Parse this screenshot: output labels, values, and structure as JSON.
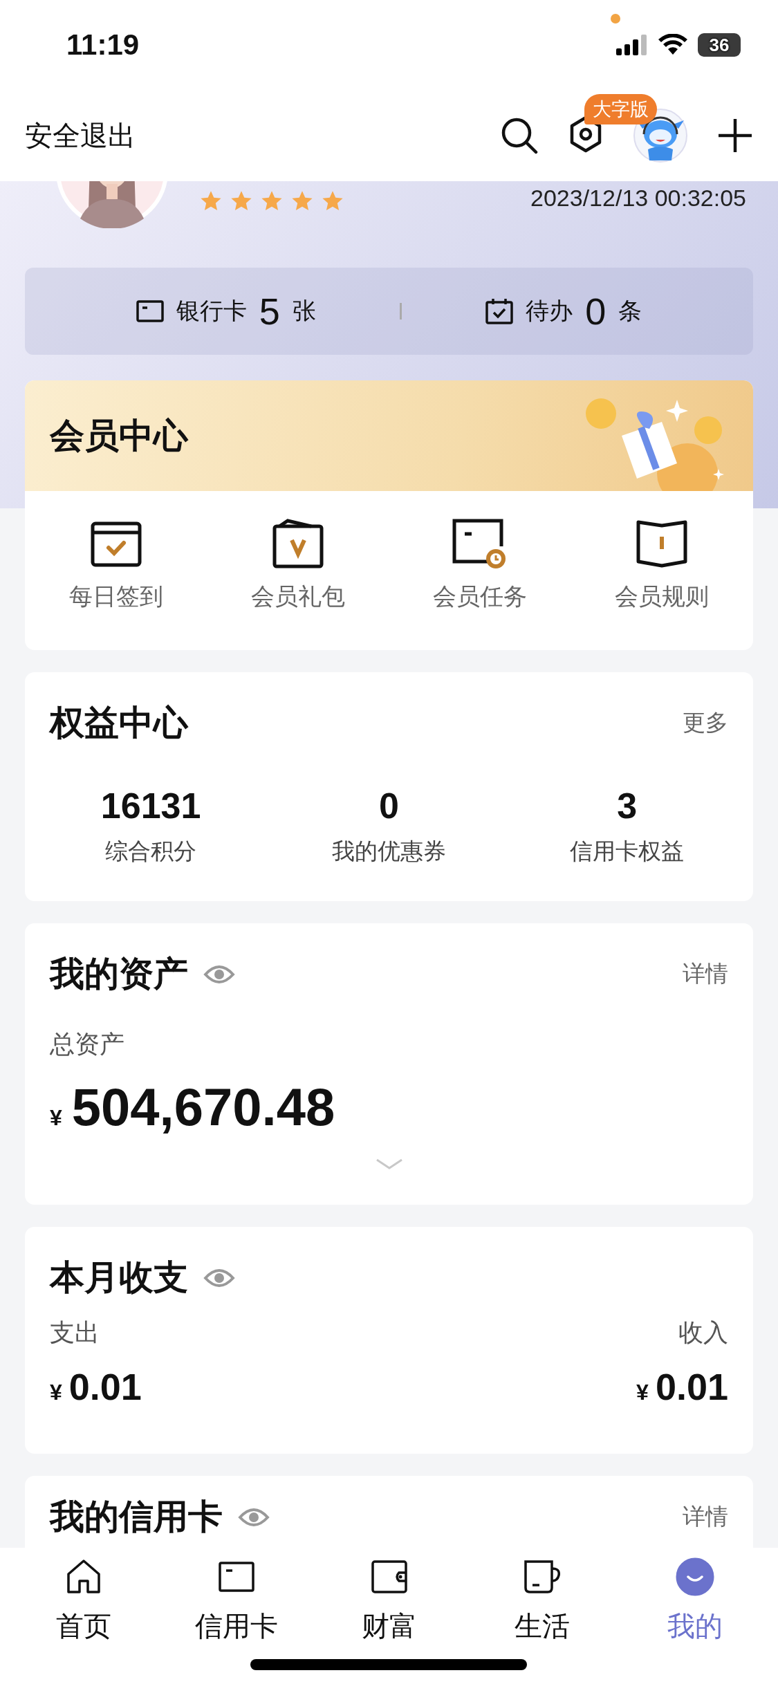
{
  "status_bar": {
    "time": "11:19",
    "battery": "36"
  },
  "header": {
    "logout": "安全退出",
    "badge": "大字版"
  },
  "profile": {
    "stars": 5,
    "last_login": "2023/12/13 00:32:05"
  },
  "summary": [
    {
      "kind": "card",
      "label": "银行卡",
      "count": "5",
      "unit": "张"
    },
    {
      "kind": "todo",
      "label": "待办",
      "count": "0",
      "unit": "条"
    }
  ],
  "member_center": {
    "title": "会员中心",
    "items": [
      {
        "kind": "checkin",
        "label": "每日签到"
      },
      {
        "kind": "gift",
        "label": "会员礼包"
      },
      {
        "kind": "task",
        "label": "会员任务"
      },
      {
        "kind": "rules",
        "label": "会员规则"
      }
    ]
  },
  "rights": {
    "title": "权益中心",
    "more": "更多",
    "stats": [
      {
        "value": "16131",
        "label": "综合积分"
      },
      {
        "value": "0",
        "label": "我的优惠券"
      },
      {
        "value": "3",
        "label": "信用卡权益"
      }
    ]
  },
  "assets": {
    "title": "我的资产",
    "detail": "详情",
    "label": "总资产",
    "currency": "¥",
    "amount": "504,670.48"
  },
  "monthly": {
    "title": "本月收支",
    "expense": {
      "label": "支出",
      "currency": "¥",
      "amount": "0.01"
    },
    "income": {
      "label": "收入",
      "currency": "¥",
      "amount": "0.01"
    }
  },
  "credit_cards": {
    "title": "我的信用卡",
    "detail": "详情"
  },
  "tabs": [
    {
      "kind": "home",
      "label": "首页",
      "selected": false
    },
    {
      "kind": "card",
      "label": "信用卡",
      "selected": false
    },
    {
      "kind": "wallet",
      "label": "财富",
      "selected": false
    },
    {
      "kind": "life",
      "label": "生活",
      "selected": false
    },
    {
      "kind": "me",
      "label": "我的",
      "selected": true
    }
  ]
}
